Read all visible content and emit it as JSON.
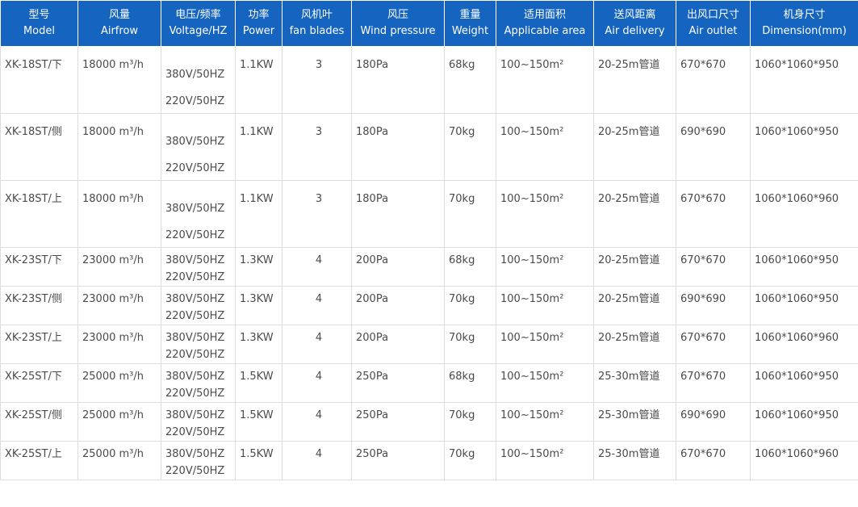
{
  "headers": [
    {
      "cn": "型号",
      "en": "Model"
    },
    {
      "cn": "风量",
      "en": "Airfrow"
    },
    {
      "cn": "电压/频率",
      "en": "Voltage/HZ"
    },
    {
      "cn": "功率",
      "en": "Power"
    },
    {
      "cn": "风机叶",
      "en": "fan blades"
    },
    {
      "cn": "风压",
      "en": "Wind pressure"
    },
    {
      "cn": "重量",
      "en": "Weight"
    },
    {
      "cn": "适用面积",
      "en": "Applicable area"
    },
    {
      "cn": "送风距离",
      "en": "Air delivery"
    },
    {
      "cn": "出风口尺寸",
      "en": "Air outlet"
    },
    {
      "cn": "机身尺寸",
      "en": "Dimension(mm)"
    }
  ],
  "rows": [
    {
      "model": "XK-18ST/下",
      "airflow": "18000 m³/h",
      "voltage1": "380V/50HZ",
      "voltage2": "220V/50HZ",
      "power": "1.1KW",
      "blades": "3",
      "pressure": "180Pa",
      "weight": "68kg",
      "area": "100~150m²",
      "delivery": "20-25m管道",
      "outlet": "670*670",
      "dimension": "1060*1060*950"
    },
    {
      "model": "XK-18ST/侧",
      "airflow": "18000 m³/h",
      "voltage1": "380V/50HZ",
      "voltage2": "220V/50HZ",
      "power": "1.1KW",
      "blades": "3",
      "pressure": "180Pa",
      "weight": "70kg",
      "area": "100~150m²",
      "delivery": "20-25m管道",
      "outlet": "690*690",
      "dimension": "1060*1060*950"
    },
    {
      "model": "XK-18ST/上",
      "airflow": "18000 m³/h",
      "voltage1": "380V/50HZ",
      "voltage2": "220V/50HZ",
      "power": "1.1KW",
      "blades": "3",
      "pressure": "180Pa",
      "weight": "70kg",
      "area": "100~150m²",
      "delivery": "20-25m管道",
      "outlet": "670*670",
      "dimension": "1060*1060*960"
    },
    {
      "model": "XK-23ST/下",
      "airflow": "23000 m³/h",
      "voltage1": "380V/50HZ",
      "voltage2": "220V/50HZ",
      "power": "1.3KW",
      "blades": "4",
      "pressure": "200Pa",
      "weight": "68kg",
      "area": "100~150m²",
      "delivery": "20-25m管道",
      "outlet": "670*670",
      "dimension": "1060*1060*950"
    },
    {
      "model": "XK-23ST/侧",
      "airflow": "23000 m³/h",
      "voltage1": "380V/50HZ",
      "voltage2": "220V/50HZ",
      "power": "1.3KW",
      "blades": "4",
      "pressure": "200Pa",
      "weight": "70kg",
      "area": "100~150m²",
      "delivery": "20-25m管道",
      "outlet": "690*690",
      "dimension": "1060*1060*950"
    },
    {
      "model": "XK-23ST/上",
      "airflow": "23000 m³/h",
      "voltage1": "380V/50HZ",
      "voltage2": "220V/50HZ",
      "power": "1.3KW",
      "blades": "4",
      "pressure": "200Pa",
      "weight": "70kg",
      "area": "100~150m²",
      "delivery": "20-25m管道",
      "outlet": "670*670",
      "dimension": "1060*1060*960"
    },
    {
      "model": "XK-25ST/下",
      "airflow": "25000 m³/h",
      "voltage1": "380V/50HZ",
      "voltage2": "220V/50HZ",
      "power": "1.5KW",
      "blades": "4",
      "pressure": "250Pa",
      "weight": "68kg",
      "area": "100~150m²",
      "delivery": "25-30m管道",
      "outlet": "670*670",
      "dimension": "1060*1060*950"
    },
    {
      "model": "XK-25ST/侧",
      "airflow": "25000 m³/h",
      "voltage1": "380V/50HZ",
      "voltage2": "220V/50HZ",
      "power": "1.5KW",
      "blades": "4",
      "pressure": "250Pa",
      "weight": "70kg",
      "area": "100~150m²",
      "delivery": "25-30m管道",
      "outlet": "690*690",
      "dimension": "1060*1060*950"
    },
    {
      "model": "XK-25ST/上",
      "airflow": "25000 m³/h",
      "voltage1": "380V/50HZ",
      "voltage2": "220V/50HZ",
      "power": "1.5KW",
      "blades": "4",
      "pressure": "250Pa",
      "weight": "70kg",
      "area": "100~150m²",
      "delivery": "25-30m管道",
      "outlet": "670*670",
      "dimension": "1060*1060*960"
    }
  ]
}
